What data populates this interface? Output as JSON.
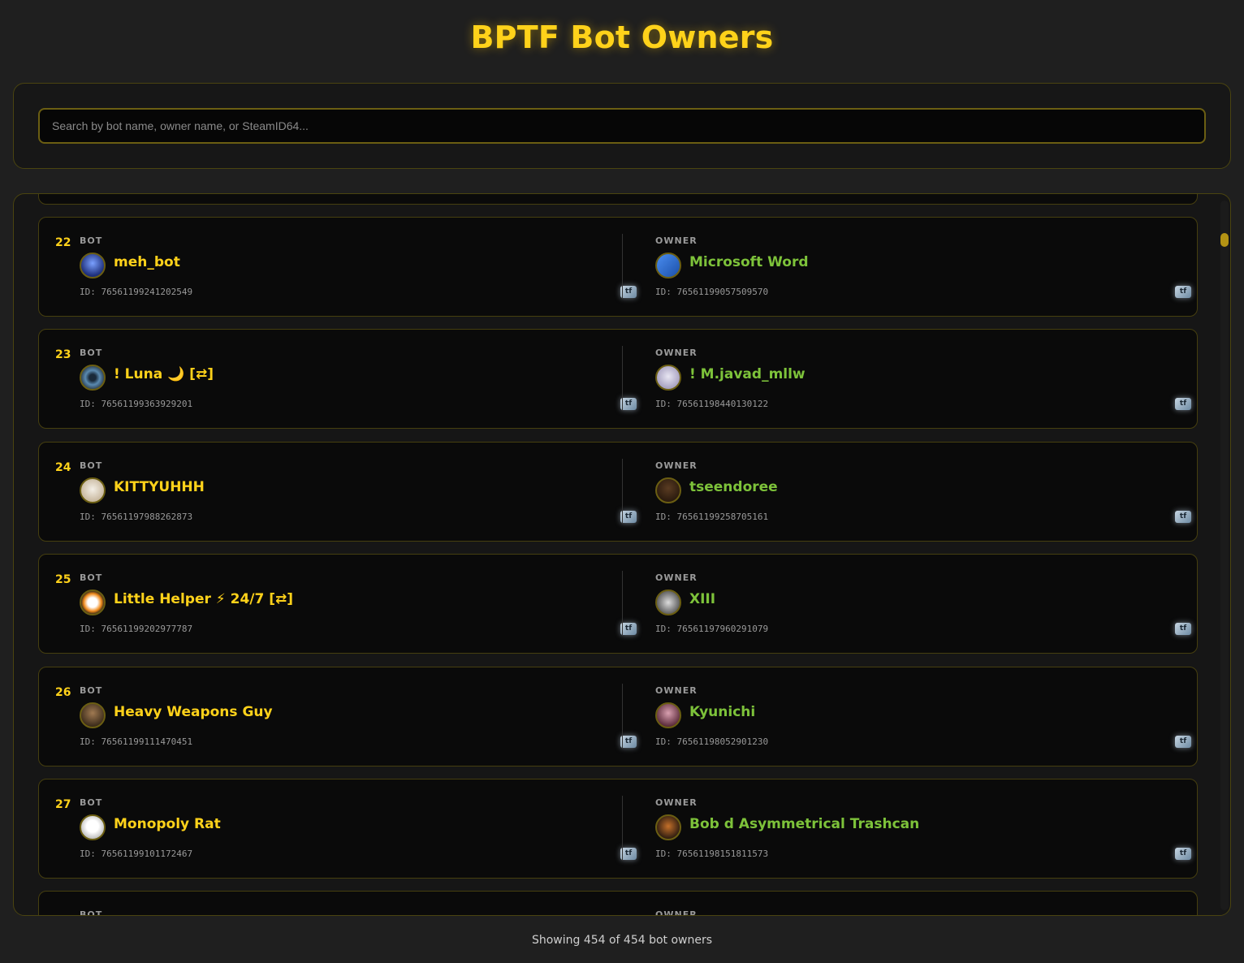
{
  "header": {
    "title": "BPTF Bot Owners"
  },
  "search": {
    "placeholder": "Search by bot name, owner name, or SteamID64..."
  },
  "labels": {
    "bot": "BOT",
    "owner": "OWNER",
    "tf_icon": "tf"
  },
  "rows": [
    {
      "rank": "22",
      "bot_name": "meh_bot",
      "bot_id": "ID: 76561199241202549",
      "owner_name": "Microsoft Word",
      "owner_id": "ID: 76561199057509570"
    },
    {
      "rank": "23",
      "bot_name": "! Luna 🌙 [⇄]",
      "bot_id": "ID: 76561199363929201",
      "owner_name": "! M.javad_mllw",
      "owner_id": "ID: 76561198440130122"
    },
    {
      "rank": "24",
      "bot_name": "KITTYUHHH",
      "bot_id": "ID: 76561197988262873",
      "owner_name": "tseendoree",
      "owner_id": "ID: 76561199258705161"
    },
    {
      "rank": "25",
      "bot_name": "Little Helper ⚡ 24/7 [⇄]",
      "bot_id": "ID: 76561199202977787",
      "owner_name": "XIII",
      "owner_id": "ID: 76561197960291079"
    },
    {
      "rank": "26",
      "bot_name": "Heavy Weapons Guy",
      "bot_id": "ID: 76561199111470451",
      "owner_name": "Kyunichi",
      "owner_id": "ID: 76561198052901230"
    },
    {
      "rank": "27",
      "bot_name": "Monopoly Rat",
      "bot_id": "ID: 76561199101172467",
      "owner_name": "Bob d Asymmetrical Trashcan",
      "owner_id": "ID: 76561198151811573"
    }
  ],
  "footer": {
    "count_text": "Showing 454 of 454 bot owners"
  },
  "colors": {
    "accent": "#ffd21a",
    "owner_name": "#7dc23a",
    "border": "#4a4410"
  }
}
